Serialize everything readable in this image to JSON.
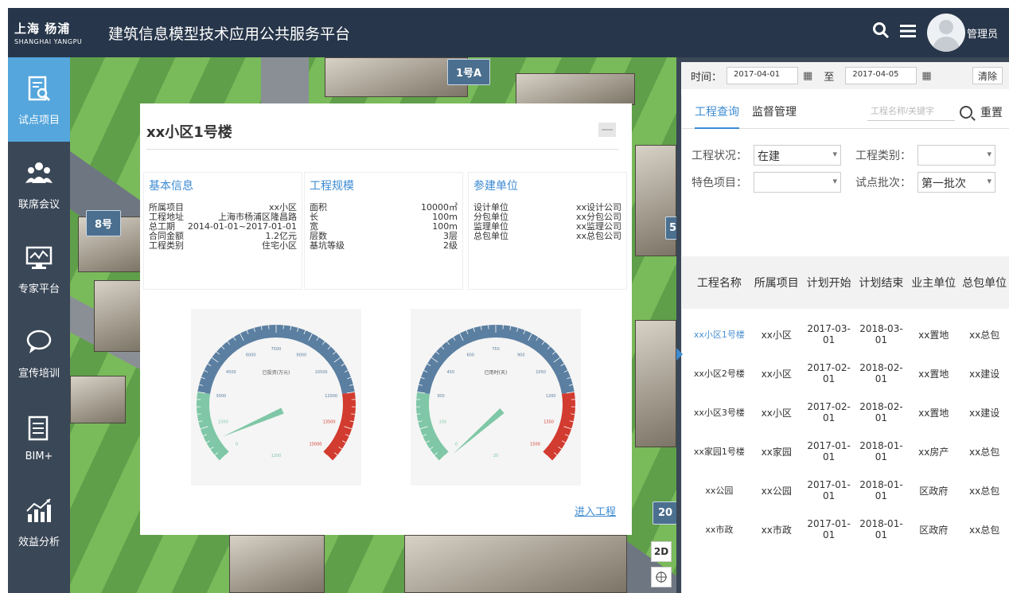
{
  "header": {
    "logo_cn": "上海  杨浦",
    "logo_en": "SHANGHAI YANGPU",
    "title": "建筑信息模型技术应用公共服务平台",
    "user": "管理员"
  },
  "sidebar": {
    "items": [
      {
        "label": "试点项目",
        "icon": "search-document-icon",
        "active": true
      },
      {
        "label": "联席会议",
        "icon": "people-icon",
        "active": false
      },
      {
        "label": "专家平台",
        "icon": "monitor-chart-icon",
        "active": false
      },
      {
        "label": "宣传培训",
        "icon": "speech-bubble-icon",
        "active": false
      },
      {
        "label": "BIM+",
        "icon": "document-stack-icon",
        "active": false
      },
      {
        "label": "效益分析",
        "icon": "bar-chart-icon",
        "active": false
      }
    ]
  },
  "map": {
    "tags": [
      "1号A",
      "8号",
      "5",
      "20"
    ],
    "ctrl_2d": "2D",
    "accent": "#4b6f8f"
  },
  "popup": {
    "title": "xx小区1号楼",
    "basic": {
      "head": "基本信息",
      "rows": [
        {
          "k": "所属项目",
          "v": "xx小区"
        },
        {
          "k": "工程地址",
          "v": "上海市杨浦区隆昌路"
        },
        {
          "k": "总工期",
          "v": "2014-01-01~2017-01-01"
        },
        {
          "k": "合同金额",
          "v": "1.2亿元"
        },
        {
          "k": "工程类别",
          "v": "住宅小区"
        }
      ]
    },
    "scale": {
      "head": "工程规模",
      "rows": [
        {
          "k": "面积",
          "v": "10000㎡"
        },
        {
          "k": "长",
          "v": "100m"
        },
        {
          "k": "宽",
          "v": "100m"
        },
        {
          "k": "层数",
          "v": "3层"
        },
        {
          "k": "基坑等级",
          "v": "2级"
        }
      ]
    },
    "units": {
      "head": "参建单位",
      "rows": [
        {
          "k": "设计单位",
          "v": "xx设计公司"
        },
        {
          "k": "分包单位",
          "v": "xx分包公司"
        },
        {
          "k": "监理单位",
          "v": "xx监理公司"
        },
        {
          "k": "总包单位",
          "v": "xx总包公司"
        }
      ]
    },
    "gauge_invest": {
      "label": "已投资(万元)",
      "ticks": [
        "0",
        "1500",
        "3000",
        "4500",
        "6000",
        "7500",
        "9000",
        "10500",
        "12000",
        "13500",
        "15000"
      ],
      "inner": "1200",
      "value": 1200,
      "max": 15000
    },
    "gauge_time": {
      "label": "已用时(天)",
      "ticks": [
        "0",
        "150",
        "300",
        "450",
        "600",
        "750",
        "900",
        "1050",
        "1200",
        "1350",
        "1500"
      ],
      "inner": "20",
      "value": 20,
      "max": 1500
    },
    "enter_link": "进入工程"
  },
  "rpanel": {
    "time_label": "时间：",
    "date_from": "2017-04-01",
    "to_label": "至",
    "date_to": "2017-04-05",
    "clear": "清除",
    "tabs": [
      "工程查询",
      "监督管理"
    ],
    "search_placeholder": "工程名称/关键字",
    "reset": "重置",
    "filters": {
      "status_label": "工程状况：",
      "status_value": "在建",
      "type_label": "工程类别：",
      "type_value": "",
      "feature_label": "特色项目：",
      "feature_value": "",
      "batch_label": "试点批次：",
      "batch_value": "第一批次"
    },
    "columns": [
      "工程名称",
      "所属项目",
      "计划开始",
      "计划结束",
      "业主单位",
      "总包单位"
    ],
    "rows": [
      [
        "xx小区1号楼",
        "xx小区",
        "2017-03-01",
        "2018-03-01",
        "xx置地",
        "xx总包"
      ],
      [
        "xx小区2号楼",
        "xx小区",
        "2017-02-01",
        "2018-02-01",
        "xx置地",
        "xx建设"
      ],
      [
        "xx小区3号楼",
        "xx小区",
        "2017-02-01",
        "2018-02-01",
        "xx置地",
        "xx建设"
      ],
      [
        "xx家园1号楼",
        "xx家园",
        "2017-01-01",
        "2018-01-01",
        "xx房产",
        "xx总包"
      ],
      [
        "xx公园",
        "xx公园",
        "2017-01-01",
        "2018-01-01",
        "区政府",
        "xx总包"
      ],
      [
        "xx市政",
        "xx市政",
        "2017-01-01",
        "2018-01-01",
        "区政府",
        "xx总包"
      ]
    ]
  }
}
